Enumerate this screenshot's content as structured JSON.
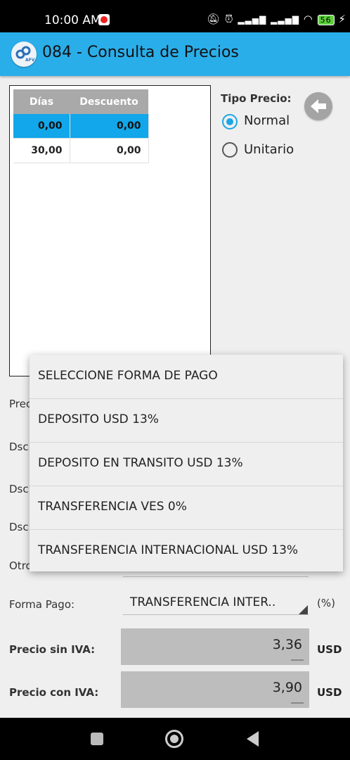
{
  "status_bar": {
    "time": "10:00 AM",
    "battery": "56"
  },
  "app_bar": {
    "logo_text": "AFV",
    "title": "084 - Consulta de Precios"
  },
  "table": {
    "headers": [
      "Días",
      "Descuento"
    ],
    "rows": [
      {
        "dias": "0,00",
        "descuento": "0,00",
        "selected": true
      },
      {
        "dias": "30,00",
        "descuento": "0,00",
        "selected": false
      }
    ]
  },
  "tipo_precio": {
    "label": "Tipo Precio:",
    "options": [
      "Normal",
      "Unitario"
    ],
    "selected": "Normal"
  },
  "fields": {
    "precio_label_partial": "Preci",
    "dsc1_partial": "Dsc",
    "dsc2_partial": "Dsc",
    "dsc3_partial": "Dsc",
    "otro_partial": "Otro",
    "forma_pago_label": "Forma Pago:",
    "forma_pago_value": "TRANSFERENCIA INTER..",
    "forma_pago_unit": "(%)",
    "precio_sin_iva_label": "Precio sin IVA:",
    "precio_sin_iva_value": "3,36",
    "precio_sin_iva_unit": "USD",
    "precio_con_iva_label": "Precio con IVA:",
    "precio_con_iva_value": "3,90",
    "precio_con_iva_unit": "USD"
  },
  "dropdown": {
    "options": [
      "SELECCIONE FORMA DE PAGO",
      "DEPOSITO USD 13%",
      "DEPOSITO EN TRANSITO USD 13%",
      "TRANSFERENCIA VES 0%",
      "TRANSFERENCIA INTERNACIONAL USD 13%"
    ]
  },
  "colors": {
    "accent": "#2aaeea",
    "selected_row": "#11a7ea",
    "header_gray": "#a9a9a9"
  }
}
